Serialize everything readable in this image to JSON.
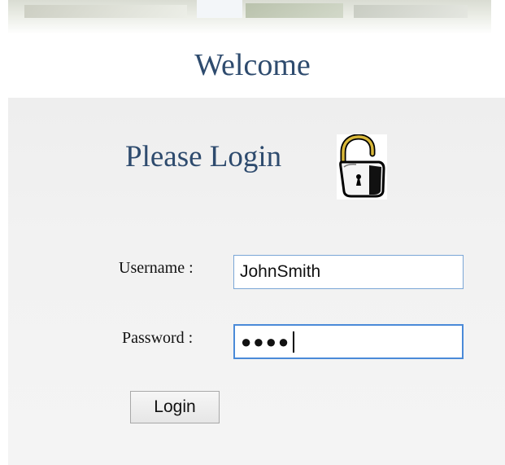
{
  "header": {
    "welcome_text": "Welcome"
  },
  "login": {
    "title": "Please Login",
    "lock_icon": "unlocked-padlock-icon",
    "username_label": "Username :",
    "username_value": "JohnSmith",
    "password_label": "Password :",
    "password_masked": "●●●●",
    "button_label": "Login"
  },
  "colors": {
    "heading": "#2e4b6e",
    "panel_bg": "#f2f2f2",
    "field_border": "#7aa6d6",
    "field_focus_border": "#4a8ad8"
  }
}
